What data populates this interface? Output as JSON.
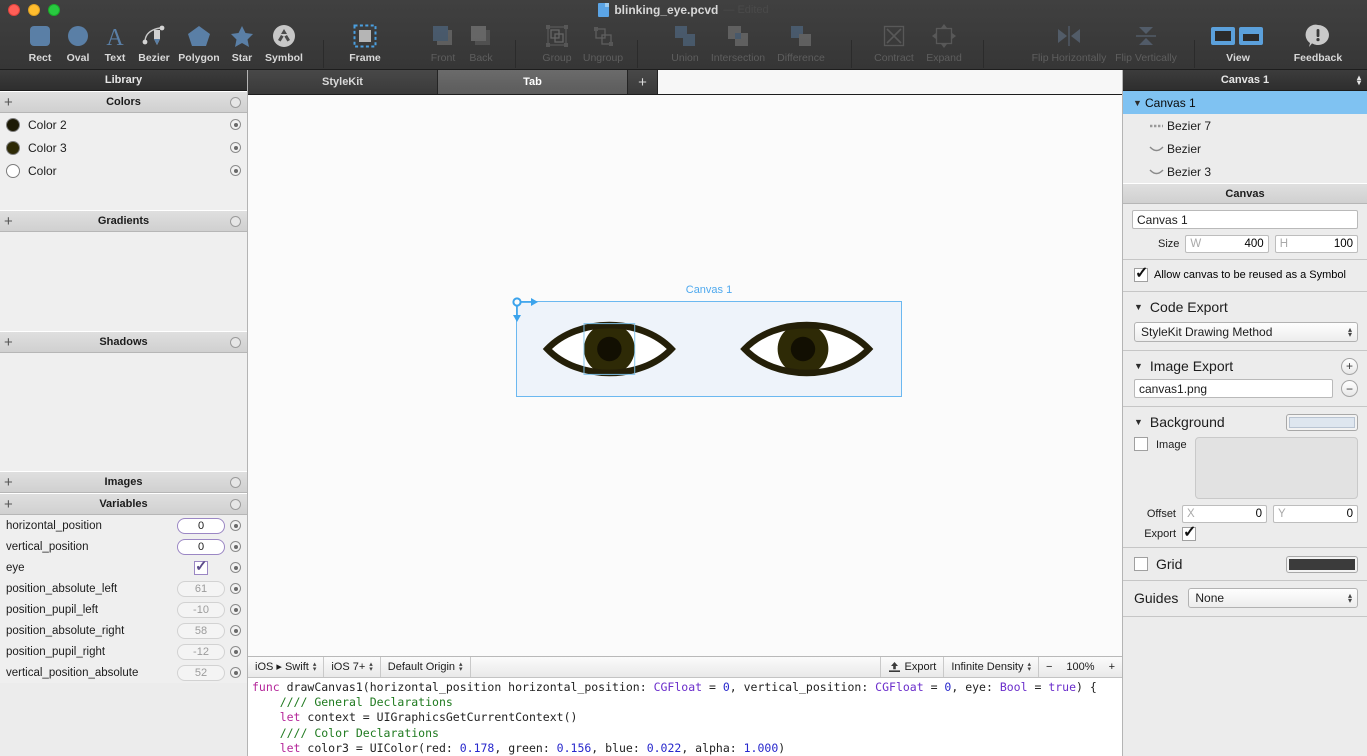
{
  "window": {
    "title": "blinking_eye.pcvd",
    "title_suffix": "— Edited",
    "traffic": [
      "close",
      "minimize",
      "zoom"
    ]
  },
  "toolbar": {
    "groups": [
      {
        "items": [
          {
            "label": "Rect",
            "icon": "rect-icon",
            "enabled": true
          },
          {
            "label": "Oval",
            "icon": "oval-icon",
            "enabled": true
          },
          {
            "label": "Text",
            "icon": "text-icon",
            "enabled": true
          },
          {
            "label": "Bezier",
            "icon": "bezier-pen-icon",
            "enabled": true
          },
          {
            "label": "Polygon",
            "icon": "polygon-icon",
            "enabled": true
          },
          {
            "label": "Star",
            "icon": "star-icon",
            "enabled": true
          },
          {
            "label": "Symbol",
            "icon": "symbol-recycle-icon",
            "enabled": true
          }
        ]
      },
      {
        "items": [
          {
            "label": "Frame",
            "icon": "frame-icon",
            "enabled": true
          },
          {
            "label": "Front",
            "icon": "bring-front-icon",
            "enabled": false
          },
          {
            "label": "Back",
            "icon": "send-back-icon",
            "enabled": false
          },
          {
            "label": "Group",
            "icon": "group-icon",
            "enabled": false
          },
          {
            "label": "Ungroup",
            "icon": "ungroup-icon",
            "enabled": false
          },
          {
            "label": "Union",
            "icon": "union-icon",
            "enabled": false
          },
          {
            "label": "Intersection",
            "icon": "intersection-icon",
            "enabled": false
          },
          {
            "label": "Difference",
            "icon": "difference-icon",
            "enabled": false
          },
          {
            "label": "Contract",
            "icon": "contract-icon",
            "enabled": false
          },
          {
            "label": "Expand",
            "icon": "expand-icon",
            "enabled": false
          },
          {
            "label": "Flip Horizontally",
            "icon": "flip-horizontal-icon",
            "enabled": false
          },
          {
            "label": "Flip Vertically",
            "icon": "flip-vertical-icon",
            "enabled": false
          },
          {
            "label": "View",
            "icon": "view-panels-icon",
            "enabled": true
          },
          {
            "label": "Feedback",
            "icon": "feedback-exclaim-icon",
            "enabled": true
          }
        ]
      }
    ]
  },
  "library": {
    "title": "Library",
    "sections": [
      {
        "name": "Colors",
        "items": [
          {
            "label": "Color 2",
            "color": "#1d1a05"
          },
          {
            "label": "Color 3",
            "color": "#2e2a06"
          },
          {
            "label": "Color",
            "color": "#ffffff"
          }
        ]
      },
      {
        "name": "Gradients",
        "items": []
      },
      {
        "name": "Shadows",
        "items": []
      },
      {
        "name": "Images",
        "items": []
      },
      {
        "name": "Variables",
        "items": []
      }
    ],
    "variables": [
      {
        "name": "horizontal_position",
        "value": "0",
        "type": "number",
        "editable": true
      },
      {
        "name": "vertical_position",
        "value": "0",
        "type": "number",
        "editable": true
      },
      {
        "name": "eye",
        "value": "",
        "type": "checkbox",
        "checked": true,
        "editable": true
      },
      {
        "name": "position_absolute_left",
        "value": "61",
        "type": "number",
        "editable": false
      },
      {
        "name": "position_pupil_left",
        "value": "-10",
        "type": "number",
        "editable": false
      },
      {
        "name": "position_absolute_right",
        "value": "58",
        "type": "number",
        "editable": false
      },
      {
        "name": "position_pupil_right",
        "value": "-12",
        "type": "number",
        "editable": false
      },
      {
        "name": "vertical_position_absolute",
        "value": "52",
        "type": "number",
        "editable": false
      }
    ]
  },
  "tabs": {
    "items": [
      {
        "label": "StyleKit",
        "active": false
      },
      {
        "label": "Tab",
        "active": true
      }
    ],
    "add_label": "+"
  },
  "canvas": {
    "label": "Canvas 1",
    "background": "#eef3fa",
    "outline": "#6bb8f0",
    "eye": {
      "lid_color": "#241f08",
      "iris_color": "#2e2a06",
      "pupil_color": "#120f02",
      "sclera_color": "#ffffff"
    }
  },
  "code_bar": {
    "platform": "iOS ▸ Swift",
    "version": "iOS 7+",
    "origin": "Default Origin",
    "export_label": "Export",
    "density": "Infinite Density",
    "zoom_minus": "−",
    "zoom": "100%",
    "zoom_plus": "+"
  },
  "code": {
    "lines": [
      [
        [
          "k-kw",
          "func "
        ],
        [
          "k-fn",
          "drawCanvas1(horizontal_position horizontal_position: "
        ],
        [
          "k-type",
          "CGFloat"
        ],
        [
          "k-fn",
          " = "
        ],
        [
          "k-num",
          "0"
        ],
        [
          "k-fn",
          ", vertical_position: "
        ],
        [
          "k-type",
          "CGFloat"
        ],
        [
          "k-fn",
          " = "
        ],
        [
          "k-num",
          "0"
        ],
        [
          "k-fn",
          ", eye: "
        ],
        [
          "k-type",
          "Bool"
        ],
        [
          "k-fn",
          " = "
        ],
        [
          "k-type",
          "true"
        ],
        [
          "k-fn",
          ") {"
        ]
      ],
      [
        [
          "k-fn",
          "    "
        ],
        [
          "k-cmt",
          "//// General Declarations"
        ]
      ],
      [
        [
          "k-fn",
          "    "
        ],
        [
          "k-kw",
          "let "
        ],
        [
          "k-fn",
          "context = UIGraphicsGetCurrentContext()"
        ]
      ],
      [
        [
          "k-fn",
          ""
        ]
      ],
      [
        [
          "k-fn",
          "    "
        ],
        [
          "k-cmt",
          "//// Color Declarations"
        ]
      ],
      [
        [
          "k-fn",
          "    "
        ],
        [
          "k-kw",
          "let "
        ],
        [
          "k-fn",
          "color3 = UIColor(red: "
        ],
        [
          "k-num",
          "0.178"
        ],
        [
          "k-fn",
          ", green: "
        ],
        [
          "k-num",
          "0.156"
        ],
        [
          "k-fn",
          ", blue: "
        ],
        [
          "k-num",
          "0.022"
        ],
        [
          "k-fn",
          ", alpha: "
        ],
        [
          "k-num",
          "1.000"
        ],
        [
          "k-fn",
          ")"
        ]
      ]
    ]
  },
  "inspector": {
    "title": "Canvas 1",
    "tree": [
      {
        "label": "Canvas 1",
        "selected": true,
        "kind": "canvas",
        "indent": 0
      },
      {
        "label": "Bezier 7",
        "selected": false,
        "kind": "bezier-dashed",
        "indent": 1
      },
      {
        "label": "Bezier",
        "selected": false,
        "kind": "bezier-curve",
        "indent": 1
      },
      {
        "label": "Bezier 3",
        "selected": false,
        "kind": "bezier-curve",
        "indent": 1
      }
    ],
    "canvas_section": {
      "header": "Canvas",
      "name_value": "Canvas 1",
      "size_label": "Size",
      "width_prefix": "W",
      "width_value": "400",
      "height_prefix": "H",
      "height_value": "100",
      "symbol_checkbox_label": "Allow canvas to be reused as a Symbol",
      "symbol_checked": true
    },
    "code_export": {
      "header": "Code Export",
      "method": "StyleKit Drawing Method"
    },
    "image_export": {
      "header": "Image Export",
      "add_label": "+",
      "remove_label": "−",
      "files": [
        "canvas1.png"
      ]
    },
    "background": {
      "header": "Background",
      "color": "#dee6ef",
      "image_label": "Image",
      "image_checked": false,
      "offset_label": "Offset",
      "offset_x_prefix": "X",
      "offset_x": "0",
      "offset_y_prefix": "Y",
      "offset_y": "0",
      "export_label": "Export",
      "export_checked": true
    },
    "grid": {
      "label": "Grid",
      "checked": false,
      "color": "#3b3b3b"
    },
    "guides": {
      "label": "Guides",
      "value": "None"
    }
  }
}
